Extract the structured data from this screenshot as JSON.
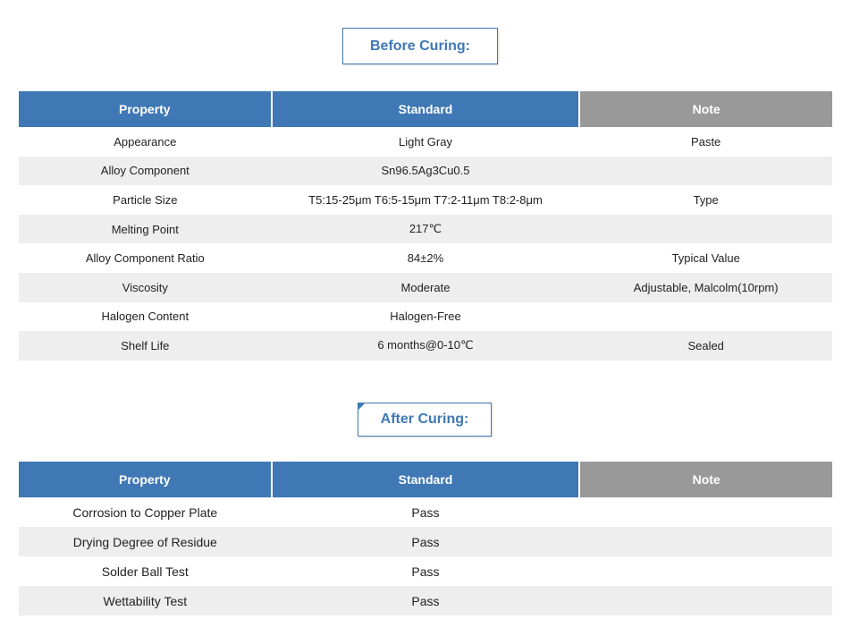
{
  "before_curing": {
    "title": "Before Curing:",
    "headers": [
      "Property",
      "Standard",
      "Note"
    ],
    "rows": [
      {
        "property": "Appearance",
        "standard": "Light Gray",
        "note": "Paste"
      },
      {
        "property": "Alloy Component",
        "standard": "Sn96.5Ag3Cu0.5",
        "note": ""
      },
      {
        "property": "Particle Size",
        "standard": "T5:15-25μm T6:5-15μm T7:2-11μm T8:2-8μm",
        "note": "Type"
      },
      {
        "property": "Melting Point",
        "standard": "217℃",
        "note": ""
      },
      {
        "property": "Alloy Component Ratio",
        "standard": "84±2%",
        "note": "Typical Value"
      },
      {
        "property": "Viscosity",
        "standard": "Moderate",
        "note": "Adjustable, Malcolm(10rpm)"
      },
      {
        "property": "Halogen Content",
        "standard": "Halogen-Free",
        "note": ""
      },
      {
        "property": "Shelf Life",
        "standard": "6 months@0-10℃",
        "note": "Sealed"
      }
    ]
  },
  "after_curing": {
    "title": "After Curing:",
    "headers": [
      "Property",
      "Standard",
      "Note"
    ],
    "rows": [
      {
        "property": "Corrosion to Copper Plate",
        "standard": "Pass",
        "note": ""
      },
      {
        "property": "Drying Degree of Residue",
        "standard": "Pass",
        "note": ""
      },
      {
        "property": "Solder Ball Test",
        "standard": "Pass",
        "note": ""
      },
      {
        "property": "Wettability Test",
        "standard": "Pass",
        "note": ""
      }
    ]
  },
  "colors": {
    "accent_blue": "#3f78b4",
    "note_header_grey": "#999999",
    "zebra_row": "#eeeeee"
  }
}
